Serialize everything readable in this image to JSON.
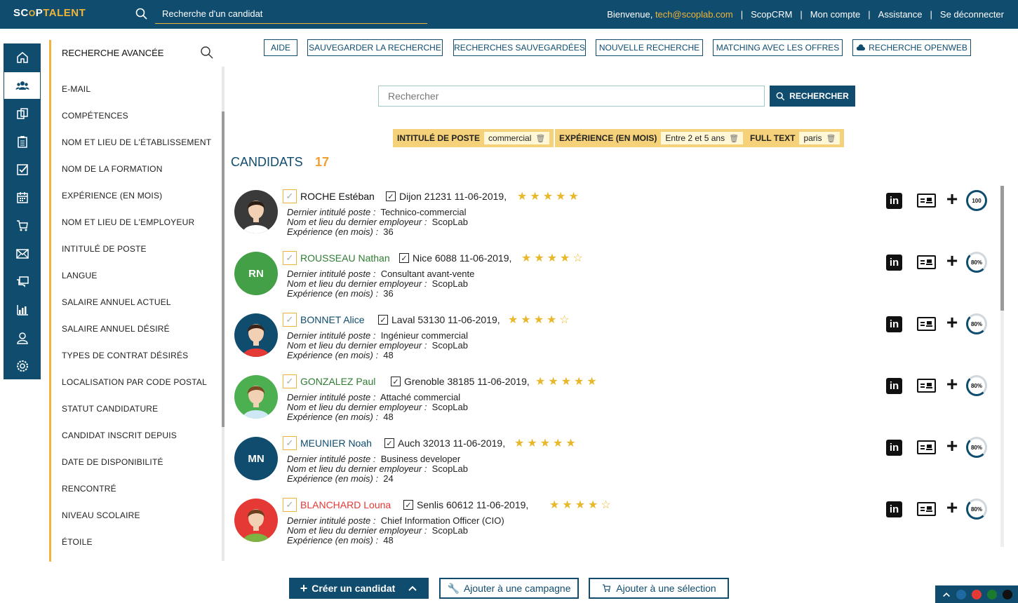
{
  "topbar": {
    "logo_part1": "SC",
    "logo_mid": "O",
    "logo_part2": "P",
    "logo_part3": "TALENT",
    "search_placeholder": "Recherche d'un candidat",
    "welcome": "Bienvenue,",
    "email": "tech@scoplab.com",
    "nav": [
      "ScopCRM",
      "Mon compte",
      "Assistance",
      "Se déconnecter"
    ]
  },
  "iconbar": [
    "home-icon",
    "candidates-icon",
    "copy-icon",
    "clipboard-icon",
    "checklist-icon",
    "calendar-icon",
    "cart-icon",
    "mail-icon",
    "chat-icon",
    "stats-icon",
    "user-icon",
    "settings-icon"
  ],
  "advanced": {
    "title": "RECHERCHE AVANCÉE",
    "items": [
      "E-MAIL",
      "COMPÉTENCES",
      "NOM ET LIEU DE L'ÉTABLISSEMENT",
      "NOM DE LA FORMATION",
      "EXPÉRIENCE (EN MOIS)",
      "NOM ET LIEU DE L'EMPLOYEUR",
      "INTITULÉ DE POSTE",
      "LANGUE",
      "SALAIRE ANNUEL ACTUEL",
      "SALAIRE ANNUEL DÉSIRÉ",
      "TYPES DE CONTRAT DÉSIRÉS",
      "LOCALISATION PAR CODE POSTAL",
      "STATUT CANDIDATURE",
      "CANDIDAT INSCRIT DEPUIS",
      "DATE DE DISPONIBILITÉ",
      "RENCONTRÉ",
      "NIVEAU SCOLAIRE",
      "ÉTOILE"
    ]
  },
  "actions": [
    "AIDE",
    "SAUVEGARDER LA RECHERCHE",
    "RECHERCHES SAUVEGARDÉES",
    "NOUVELLE RECHERCHE",
    "MATCHING AVEC LES OFFRES",
    "RECHERCHE OPENWEB"
  ],
  "search": {
    "placeholder": "Rechercher",
    "button": "RECHERCHER"
  },
  "filters": [
    {
      "label": "INTITULÉ DE POSTE",
      "value": "commercial"
    },
    {
      "label": "EXPÉRIENCE (EN MOIS)",
      "value": "Entre 2 et 5 ans"
    },
    {
      "label": "FULL TEXT",
      "value": "paris"
    }
  ],
  "candidates_title": "CANDIDATS",
  "candidates_count": "17",
  "labels": {
    "poste": "Dernier intitulé poste :",
    "employeur": "Nom et lieu du dernier employeur :",
    "experience": "Expérience (en mois) :"
  },
  "candidates": [
    {
      "name": "ROCHE Estéban",
      "name_color": "#111111",
      "location": "Dijon 21231 11-06-2019,",
      "rating": 5,
      "poste": "Technico-commercial",
      "employeur": "ScopLab",
      "experience": "36",
      "score": "100",
      "avatar_type": "photo",
      "avatar_bg": "#3a3a3a",
      "initials": ""
    },
    {
      "name": "ROUSSEAU Nathan",
      "name_color": "#2e7d32",
      "location": "Nice 6088 11-06-2019,",
      "rating": 4,
      "poste": "Consultant avant-vente",
      "employeur": "ScopLab",
      "experience": "36",
      "score": "80%",
      "avatar_type": "initials",
      "avatar_bg": "#43a047",
      "initials": "RN"
    },
    {
      "name": "BONNET Alice",
      "name_color": "#0f4c6e",
      "location": "Laval 53130 11-06-2019,",
      "rating": 4,
      "poste": "Ingénieur commercial",
      "employeur": "ScopLab",
      "experience": "48",
      "score": "80%",
      "avatar_type": "photo",
      "avatar_bg": "#0f4c6e",
      "initials": ""
    },
    {
      "name": "GONZALEZ Paul",
      "name_color": "#2e7d32",
      "location": "Grenoble 38185 11-06-2019,",
      "rating": 5,
      "poste": "Attaché commercial",
      "employeur": "ScopLab",
      "experience": "48",
      "score": "80%",
      "avatar_type": "photo",
      "avatar_bg": "#4caf50",
      "initials": ""
    },
    {
      "name": "MEUNIER Noah",
      "name_color": "#0f4c6e",
      "location": "Auch 32013 11-06-2019,",
      "rating": 5,
      "poste": "Business developer",
      "employeur": "ScopLab",
      "experience": "24",
      "score": "80%",
      "avatar_type": "initials",
      "avatar_bg": "#0f4c6e",
      "initials": "MN"
    },
    {
      "name": "BLANCHARD Louna",
      "name_color": "#e53935",
      "location": "Senlis 60612 11-06-2019,",
      "rating": 4,
      "poste": "Chief Information Officer (CIO)",
      "employeur": "ScopLab",
      "experience": "48",
      "score": "80%",
      "avatar_type": "photo",
      "avatar_bg": "#e53935",
      "initials": ""
    }
  ],
  "bottom": {
    "create": "Créer un candidat",
    "campaign": "Ajouter à une campagne",
    "selection": "Ajouter à une sélection"
  },
  "theme_colors": [
    "#1e6aa0",
    "#e53935",
    "#1b7a2e",
    "#111111"
  ]
}
